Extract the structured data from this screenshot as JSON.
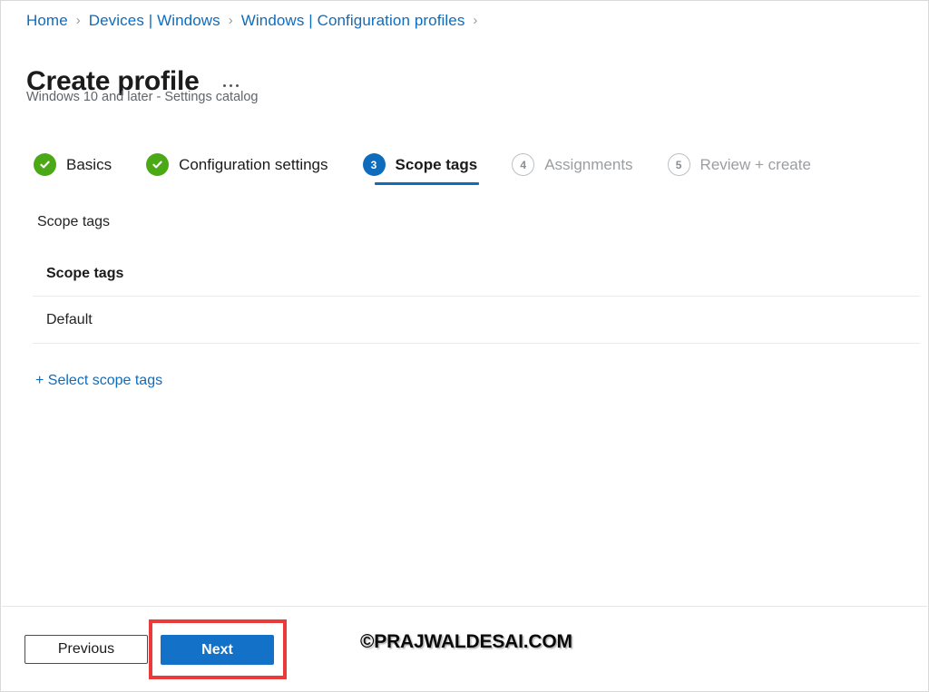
{
  "breadcrumb": {
    "items": [
      {
        "label": "Home"
      },
      {
        "label": "Devices | Windows"
      },
      {
        "label": "Windows | Configuration profiles"
      }
    ],
    "separator": "›",
    "trailing_separator": "›"
  },
  "header": {
    "title": "Create profile",
    "subtitle": "Windows 10 and later - Settings catalog",
    "more_menu_name": "more-options"
  },
  "wizard": {
    "steps": [
      {
        "number": "1",
        "label": "Basics",
        "state": "done"
      },
      {
        "number": "2",
        "label": "Configuration settings",
        "state": "done"
      },
      {
        "number": "3",
        "label": "Scope tags",
        "state": "active"
      },
      {
        "number": "4",
        "label": "Assignments",
        "state": "todo"
      },
      {
        "number": "5",
        "label": "Review + create",
        "state": "todo"
      }
    ]
  },
  "main": {
    "section_label": "Scope tags",
    "table": {
      "header": "Scope tags",
      "rows": [
        {
          "name": "Default"
        }
      ]
    },
    "select_scope_tags_link": "+ Select scope tags"
  },
  "footer": {
    "previous_label": "Previous",
    "next_label": "Next",
    "watermark": "©PRAJWALDESAI.COM"
  },
  "colors": {
    "accent_blue": "#0f6cbd",
    "link_blue": "#0f6cbd",
    "next_button_blue": "#1371c8",
    "step_done_green": "#4ca916",
    "highlight_red": "#eb3a3a",
    "text_primary": "#1b1b1b",
    "text_muted": "#9b9da0"
  }
}
